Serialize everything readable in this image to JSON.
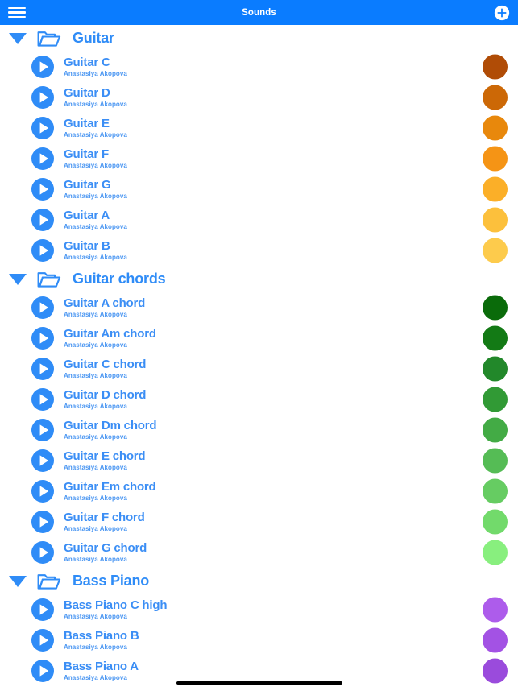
{
  "header": {
    "title": "Sounds",
    "menu_icon": "hamburger-menu-icon",
    "add_icon": "add-circle-icon",
    "background_color": "#0a7cff",
    "title_color": "#ffffff"
  },
  "theme": {
    "accent_blue": "#2f8cf7",
    "row_title_color": "#3b8ef5",
    "row_subtitle_color": "#4a96f2",
    "page_background": "#ffffff"
  },
  "groups": [
    {
      "title": "Guitar",
      "expanded": true,
      "expand_icon": "triangle-down-icon",
      "folder_icon": "folder-open-icon",
      "items": [
        {
          "title": "Guitar C",
          "artist": "Anastasiya Akopova",
          "color": "#b04c06",
          "play_icon": "play-circle-icon"
        },
        {
          "title": "Guitar D",
          "artist": "Anastasiya Akopova",
          "color": "#cc6806",
          "play_icon": "play-circle-icon"
        },
        {
          "title": "Guitar E",
          "artist": "Anastasiya Akopova",
          "color": "#e8880c",
          "play_icon": "play-circle-icon"
        },
        {
          "title": "Guitar F",
          "artist": "Anastasiya Akopova",
          "color": "#f59415",
          "play_icon": "play-circle-icon"
        },
        {
          "title": "Guitar G",
          "artist": "Anastasiya Akopova",
          "color": "#fbaf28",
          "play_icon": "play-circle-icon"
        },
        {
          "title": "Guitar A",
          "artist": "Anastasiya Akopova",
          "color": "#fcc03c",
          "play_icon": "play-circle-icon"
        },
        {
          "title": "Guitar B",
          "artist": "Anastasiya Akopova",
          "color": "#fdcb4c",
          "play_icon": "play-circle-icon"
        }
      ]
    },
    {
      "title": "Guitar chords",
      "expanded": true,
      "expand_icon": "triangle-down-icon",
      "folder_icon": "folder-open-icon",
      "items": [
        {
          "title": "Guitar A chord",
          "artist": "Anastasiya Akopova",
          "color": "#0a6b0a",
          "play_icon": "play-circle-icon"
        },
        {
          "title": "Guitar Am chord",
          "artist": "Anastasiya Akopova",
          "color": "#137a15",
          "play_icon": "play-circle-icon"
        },
        {
          "title": "Guitar C chord",
          "artist": "Anastasiya Akopova",
          "color": "#22882a",
          "play_icon": "play-circle-icon"
        },
        {
          "title": "Guitar D chord",
          "artist": "Anastasiya Akopova",
          "color": "#319a35",
          "play_icon": "play-circle-icon"
        },
        {
          "title": "Guitar Dm chord",
          "artist": "Anastasiya Akopova",
          "color": "#43ab45",
          "play_icon": "play-circle-icon"
        },
        {
          "title": "Guitar E chord",
          "artist": "Anastasiya Akopova",
          "color": "#55bc55",
          "play_icon": "play-circle-icon"
        },
        {
          "title": "Guitar Em chord",
          "artist": "Anastasiya Akopova",
          "color": "#66cc62",
          "play_icon": "play-circle-icon"
        },
        {
          "title": "Guitar F chord",
          "artist": "Anastasiya Akopova",
          "color": "#72da6b",
          "play_icon": "play-circle-icon"
        },
        {
          "title": "Guitar G chord",
          "artist": "Anastasiya Akopova",
          "color": "#88ef7e",
          "play_icon": "play-circle-icon"
        }
      ]
    },
    {
      "title": "Bass Piano",
      "expanded": true,
      "expand_icon": "triangle-down-icon",
      "folder_icon": "folder-open-icon",
      "items": [
        {
          "title": "Bass Piano C high",
          "artist": "Anastasiya Akopova",
          "color": "#ad5ceb",
          "play_icon": "play-circle-icon"
        },
        {
          "title": "Bass Piano B",
          "artist": "Anastasiya Akopova",
          "color": "#a352e4",
          "play_icon": "play-circle-icon"
        },
        {
          "title": "Bass Piano A",
          "artist": "Anastasiya Akopova",
          "color": "#9a4bdc",
          "play_icon": "play-circle-icon"
        }
      ]
    }
  ],
  "home_indicator": {
    "name": "home-indicator",
    "color": "#000000"
  }
}
